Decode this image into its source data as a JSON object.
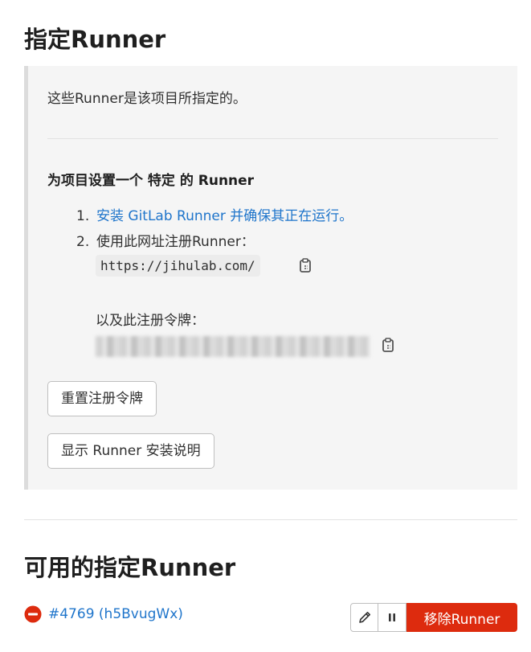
{
  "page": {
    "title": "指定Runner",
    "description": "这些Runner是该项目所指定的。",
    "setup_title": "为项目设置一个 特定 的 Runner",
    "steps": [
      {
        "num": "1.",
        "link_text": "安装 GitLab Runner 并确保其正在运行。"
      },
      {
        "num": "2.",
        "text": "使用此网址注册Runner："
      }
    ],
    "registration_url": "https://jihulab.com/",
    "token_label": "以及此注册令牌：",
    "reset_button": "重置注册令牌",
    "show_install_button": "显示 Runner 安装说明"
  },
  "available": {
    "title": "可用的指定Runner",
    "runners": [
      {
        "link": "#4769 (h5BvugWx)",
        "remove_label": "移除Runner"
      }
    ]
  },
  "icons": {
    "copy": "clipboard-icon",
    "edit": "pencil-icon",
    "pause": "pause-icon",
    "status": "status-offline-icon"
  },
  "colors": {
    "link": "#1f75cb",
    "danger": "#dd2b0e",
    "panel_bg": "#f5f5f5"
  }
}
